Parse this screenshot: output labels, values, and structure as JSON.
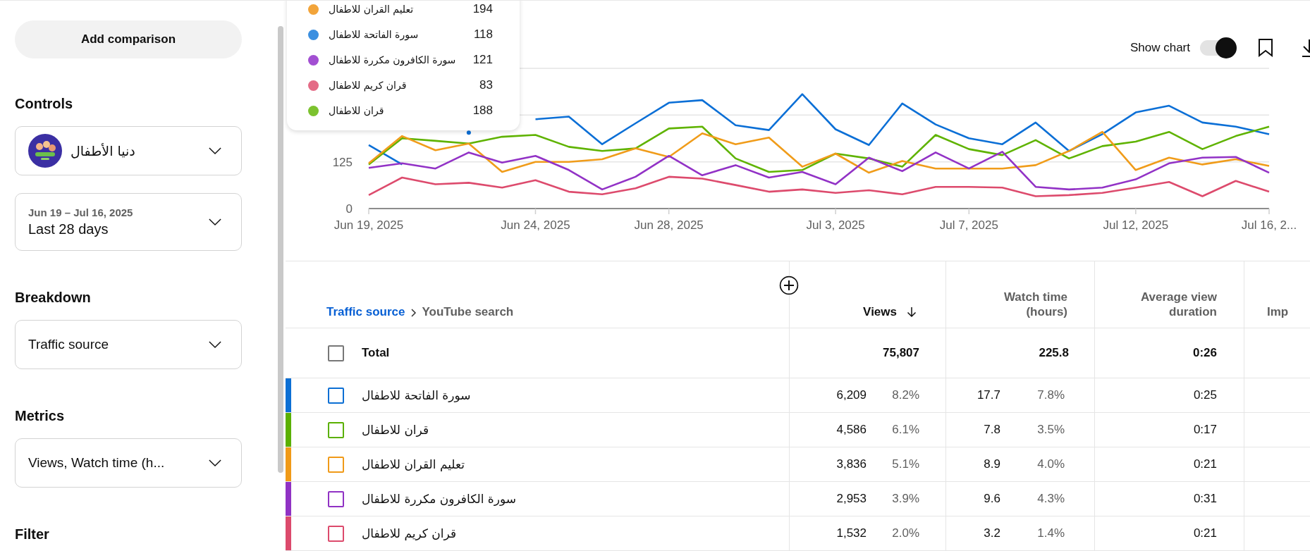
{
  "sidebar": {
    "add_button": "Add comparison",
    "sections": [
      {
        "heading": "Controls",
        "selects": [
          {
            "kind": "channel",
            "value": "دنيا الأطفال"
          },
          {
            "kind": "date",
            "caption": "Jun 19 – Jul 16, 2025",
            "value": "Last 28 days"
          }
        ]
      },
      {
        "heading": "Breakdown",
        "selects": [
          {
            "kind": "plain",
            "value": "Traffic source"
          }
        ]
      },
      {
        "heading": "Metrics",
        "selects": [
          {
            "kind": "plain",
            "value": "Views, Watch time (h..."
          }
        ]
      },
      {
        "heading": "Filter"
      }
    ]
  },
  "chart_header": {
    "show_chart_label": "Show chart",
    "show_chart_on": true
  },
  "tooltip": {
    "items": [
      {
        "label": "تعليم القران للاطفال",
        "value": "194",
        "color": "#f2a43a"
      },
      {
        "label": "سورة الفاتحة للاطفال",
        "value": "118",
        "color": "#3b8fe0"
      },
      {
        "label": "سورة الكافرون مكررة للاطفال",
        "value": "121",
        "color": "#a24fd2"
      },
      {
        "label": "قران كريم للاطفال",
        "value": "83",
        "color": "#e46b86"
      },
      {
        "label": "قران للاطفال",
        "value": "188",
        "color": "#7cc22f"
      }
    ]
  },
  "chart_data": {
    "type": "line",
    "categories": [
      "Jun 19, 2025",
      null,
      null,
      null,
      null,
      "Jun 24, 2025",
      null,
      null,
      null,
      "Jun 28, 2025",
      null,
      null,
      null,
      null,
      "Jul 3, 2025",
      null,
      null,
      null,
      "Jul 7, 2025",
      null,
      null,
      null,
      null,
      "Jul 12, 2025",
      null,
      null,
      null,
      "Jul 16, 2..."
    ],
    "ylim": [
      0,
      375
    ],
    "yticks": [
      0,
      125
    ],
    "series": [
      {
        "color": "#0b6fd6",
        "values": [
          170,
          118,
          null,
          203,
          null,
          239,
          246,
          172,
          228,
          283,
          290,
          223,
          210,
          306,
          212,
          170,
          281,
          225,
          188,
          172,
          230,
          154,
          199,
          257,
          275,
          230,
          219,
          199
        ]
      },
      {
        "color": "#5fb300",
        "values": [
          118,
          188,
          181,
          174,
          192,
          197,
          165,
          154,
          161,
          214,
          219,
          134,
          98,
          103,
          147,
          134,
          112,
          197,
          159,
          143,
          183,
          134,
          167,
          179,
          205,
          159,
          194,
          219
        ]
      },
      {
        "color": "#f09c1a",
        "values": [
          121,
          194,
          156,
          174,
          98,
          125,
          125,
          132,
          161,
          138,
          201,
          172,
          190,
          112,
          147,
          96,
          127,
          107,
          107,
          107,
          116,
          154,
          205,
          103,
          136,
          118,
          132,
          114
        ]
      },
      {
        "color": "#9232c6",
        "values": [
          109,
          121,
          107,
          150,
          123,
          141,
          103,
          51,
          85,
          141,
          89,
          116,
          83,
          98,
          65,
          136,
          100,
          150,
          107,
          152,
          58,
          51,
          56,
          78,
          121,
          136,
          138,
          96
        ]
      },
      {
        "color": "#dd4b6d",
        "values": [
          36,
          83,
          65,
          69,
          56,
          76,
          45,
          38,
          54,
          85,
          80,
          63,
          45,
          51,
          42,
          49,
          38,
          58,
          58,
          56,
          33,
          36,
          42,
          56,
          71,
          33,
          74,
          45
        ]
      }
    ]
  },
  "table": {
    "breadcrumb": {
      "link": "Traffic source",
      "current": "YouTube search"
    },
    "columns": [
      {
        "label": "Views",
        "sorted": true
      },
      {
        "label": "Watch time (hours)",
        "sorted": false
      },
      {
        "label": "Average view duration",
        "sorted": false
      },
      {
        "label": "Imp",
        "sorted": false
      }
    ],
    "total": {
      "label": "Total",
      "checked": false,
      "views": "75,807",
      "watch_time": "225.8",
      "avg_duration": "0:26"
    },
    "rows": [
      {
        "name": "سورة الفاتحة للاطفال",
        "color": "#0c6fd4",
        "checked": false,
        "views": "6,209",
        "views_share": "8.2%",
        "watch_time": "17.7",
        "watch_share": "7.8%",
        "avg_duration": "0:25"
      },
      {
        "name": "قران للاطفال",
        "color": "#5ab000",
        "checked": false,
        "views": "4,586",
        "views_share": "6.1%",
        "watch_time": "7.8",
        "watch_share": "3.5%",
        "avg_duration": "0:17"
      },
      {
        "name": "تعليم القران للاطفال",
        "color": "#f09a18",
        "checked": false,
        "views": "3,836",
        "views_share": "5.1%",
        "watch_time": "8.9",
        "watch_share": "4.0%",
        "avg_duration": "0:21"
      },
      {
        "name": "سورة الكافرون مكررة للاطفال",
        "color": "#9032c4",
        "checked": false,
        "views": "2,953",
        "views_share": "3.9%",
        "watch_time": "9.6",
        "watch_share": "4.3%",
        "avg_duration": "0:31"
      },
      {
        "name": "قران كريم للاطفال",
        "color": "#dc4a6c",
        "checked": false,
        "views": "1,532",
        "views_share": "2.0%",
        "watch_time": "3.2",
        "watch_share": "1.4%",
        "avg_duration": "0:21"
      }
    ]
  }
}
